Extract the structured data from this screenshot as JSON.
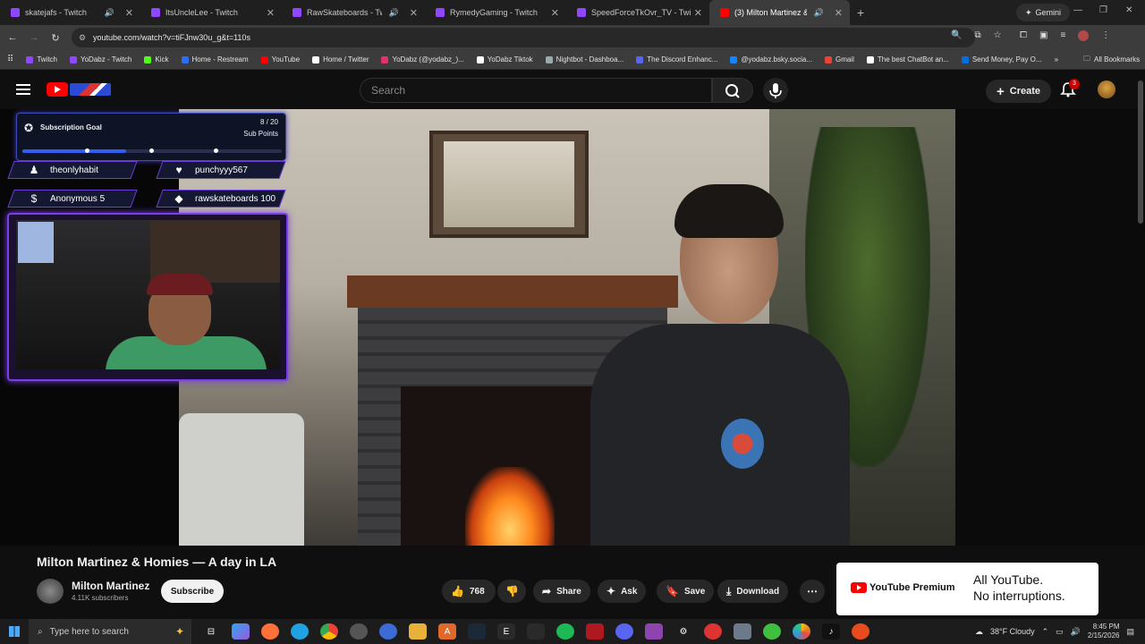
{
  "browser": {
    "tabs": [
      {
        "title": "skatejafs - Twitch",
        "color": "#9146ff",
        "audio": true
      },
      {
        "title": "ItsUncleLee - Twitch",
        "color": "#9146ff",
        "audio": false
      },
      {
        "title": "RawSkateboards - Twitch",
        "color": "#9146ff",
        "audio": true
      },
      {
        "title": "RymedyGaming - Twitch",
        "color": "#9146ff",
        "audio": false
      },
      {
        "title": "SpeedForceTkOvr_TV - Twitch",
        "color": "#9146ff",
        "audio": false
      },
      {
        "title": "(3) Milton Martinez & Hom",
        "color": "#ff0000",
        "audio": true
      }
    ],
    "gemini_label": "Gemini",
    "url": "youtube.com/watch?v=tiFJnw30u_g&t=110s",
    "bookmarks": [
      {
        "label": "Twitch",
        "color": "#9146ff"
      },
      {
        "label": "YoDabz - Twitch",
        "color": "#9146ff"
      },
      {
        "label": "Kick",
        "color": "#53fc18"
      },
      {
        "label": "Home - Restream",
        "color": "#2e6cf6"
      },
      {
        "label": "YouTube",
        "color": "#ff0000"
      },
      {
        "label": "Home / Twitter",
        "color": "#ffffff"
      },
      {
        "label": "YoDabz (@yodabz_)...",
        "color": "#e1306c"
      },
      {
        "label": "YoDabz Tiktok",
        "color": "#ffffff"
      },
      {
        "label": "Nightbot - Dashboa...",
        "color": "#9aa"
      },
      {
        "label": "The Discord Enhanc...",
        "color": "#5865f2"
      },
      {
        "label": "@yodabz.bsky.socia...",
        "color": "#1185fe"
      },
      {
        "label": "Gmail",
        "color": "#ea4335"
      },
      {
        "label": "The best ChatBot an...",
        "color": "#ffffff"
      },
      {
        "label": "Send Money, Pay O...",
        "color": "#0070e0"
      }
    ],
    "all_bookmarks": "All Bookmarks"
  },
  "youtube": {
    "search_placeholder": "Search",
    "create_label": "Create",
    "notification_count": "3",
    "video_title": "Milton Martinez & Homies — A day in LA",
    "channel_name": "Milton Martinez",
    "subscribers": "4.11K subscribers",
    "subscribe_label": "Subscribe",
    "likes": "768",
    "share_label": "Share",
    "ask_label": "Ask",
    "save_label": "Save",
    "download_label": "Download",
    "premium_logo": "YouTube Premium",
    "premium_line1": "All YouTube.",
    "premium_line2": "No interruptions."
  },
  "stream_overlay": {
    "goal_label": "Subscription Goal",
    "goal_count": "8 / 20",
    "goal_unit": "Sub Points",
    "goal_progress": 0.4,
    "events": [
      {
        "icon": "follow-icon",
        "text": "theonlyhabit"
      },
      {
        "icon": "heart-icon",
        "text": "punchyyy567"
      },
      {
        "icon": "dollar-icon",
        "text": "Anonymous 5"
      },
      {
        "icon": "diamond-icon",
        "text": "rawskateboards 100"
      }
    ]
  },
  "taskbar": {
    "search_placeholder": "Type here to search",
    "weather": "38°F  Cloudy",
    "time": "8:45 PM",
    "date": "2/15/2026"
  }
}
